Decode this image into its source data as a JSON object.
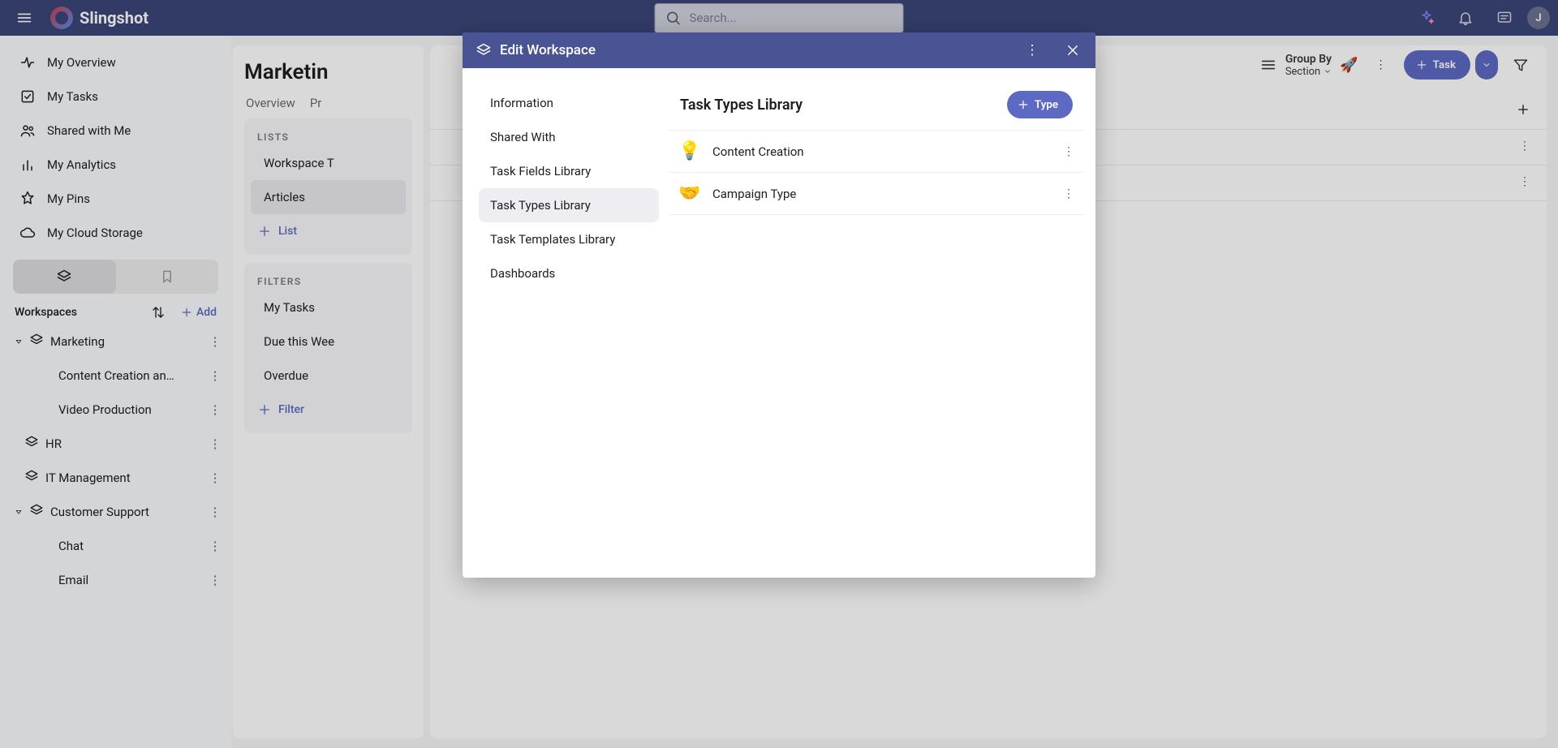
{
  "brand": {
    "name": "Slingshot"
  },
  "search": {
    "placeholder": "Search..."
  },
  "avatar": {
    "initial": "J"
  },
  "nav": {
    "items": [
      {
        "label": "My Overview"
      },
      {
        "label": "My Tasks"
      },
      {
        "label": "Shared with Me"
      },
      {
        "label": "My Analytics"
      },
      {
        "label": "My Pins"
      },
      {
        "label": "My Cloud Storage"
      }
    ]
  },
  "workspaces": {
    "title": "Workspaces",
    "add_label": "Add",
    "tree": {
      "marketing": {
        "label": "Marketing"
      },
      "content_creation": {
        "label": "Content Creation an…"
      },
      "video_production": {
        "label": "Video Production"
      },
      "hr": {
        "label": "HR"
      },
      "it_management": {
        "label": "IT Management"
      },
      "customer_support": {
        "label": "Customer Support"
      },
      "chat": {
        "label": "Chat"
      },
      "email": {
        "label": "Email"
      }
    }
  },
  "page": {
    "title": "Marketin",
    "tabs": {
      "overview": "Overview",
      "pr": "Pr"
    }
  },
  "lists": {
    "header": "LISTS",
    "workspace_tasks": "Workspace T",
    "articles": "Articles",
    "add_list": "List",
    "filters_header": "FILTERS",
    "my_tasks": "My Tasks",
    "due_this_week": "Due this Wee",
    "overdue": "Overdue",
    "add_filter": "Filter"
  },
  "toolbar": {
    "groupby_label": "Group By",
    "groupby_value": "Section",
    "task_button": "Task"
  },
  "modal": {
    "title": "Edit Workspace",
    "nav": {
      "information": "Information",
      "shared_with": "Shared With",
      "task_fields": "Task Fields Library",
      "task_types": "Task Types Library",
      "task_templates": "Task Templates Library",
      "dashboards": "Dashboards"
    },
    "main_title": "Task Types Library",
    "type_button": "Type",
    "types": [
      {
        "emoji": "💡",
        "name": "Content Creation"
      },
      {
        "emoji": "🤝",
        "name": "Campaign Type"
      }
    ]
  }
}
